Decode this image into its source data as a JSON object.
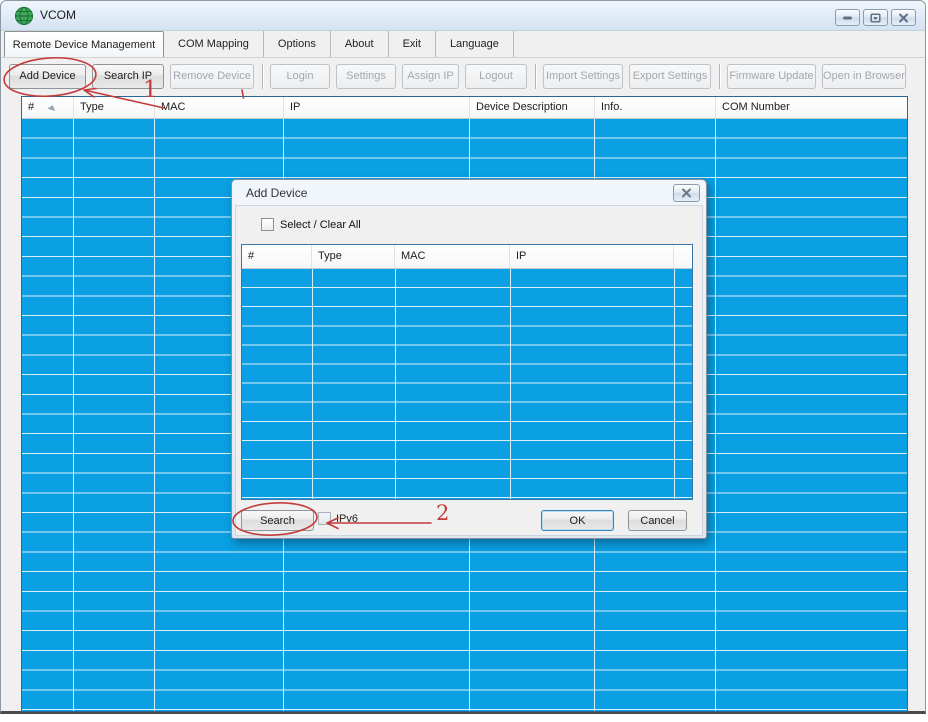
{
  "colors": {
    "row_cyan": "#0aa0e3",
    "grid_line": "#d6f1fb",
    "table_border": "#2a6899",
    "annotation_red": "#c43b3b"
  },
  "window": {
    "title": "VCOM",
    "icon": "globe-icon",
    "controls": [
      "minimize",
      "maximize",
      "close"
    ]
  },
  "tabs": [
    {
      "label": "Remote Device Management",
      "active": true
    },
    {
      "label": "COM Mapping",
      "active": false
    },
    {
      "label": "Options",
      "active": false
    },
    {
      "label": "About",
      "active": false
    },
    {
      "label": "Exit",
      "active": false
    },
    {
      "label": "Language",
      "active": false
    }
  ],
  "toolbar": [
    {
      "label": "Add Device",
      "enabled": true
    },
    {
      "label": "Search IP",
      "enabled": true
    },
    {
      "label": "Remove Device",
      "enabled": false
    },
    {
      "label": "Login",
      "enabled": false
    },
    {
      "label": "Settings",
      "enabled": false
    },
    {
      "label": "Assign IP",
      "enabled": false
    },
    {
      "label": "Logout",
      "enabled": false
    },
    {
      "label": "Import Settings",
      "enabled": false
    },
    {
      "label": "Export Settings",
      "enabled": false
    },
    {
      "label": "Firmware Update",
      "enabled": false
    },
    {
      "label": "Open in Browser",
      "enabled": false
    }
  ],
  "main_table": {
    "columns": [
      "#",
      "Type",
      "MAC",
      "IP",
      "Device Description",
      "Info.",
      "COM Number"
    ],
    "rows": []
  },
  "dialog": {
    "title": "Add Device",
    "select_all": {
      "label": "Select / Clear All",
      "checked": false
    },
    "table": {
      "columns": [
        "#",
        "Type",
        "MAC",
        "IP"
      ],
      "rows": []
    },
    "ipv6": {
      "label": "IPv6",
      "checked": false
    },
    "buttons": {
      "search": "Search",
      "ok": "OK",
      "cancel": "Cancel"
    }
  },
  "annotations": {
    "step1": "1",
    "step2": "2"
  }
}
